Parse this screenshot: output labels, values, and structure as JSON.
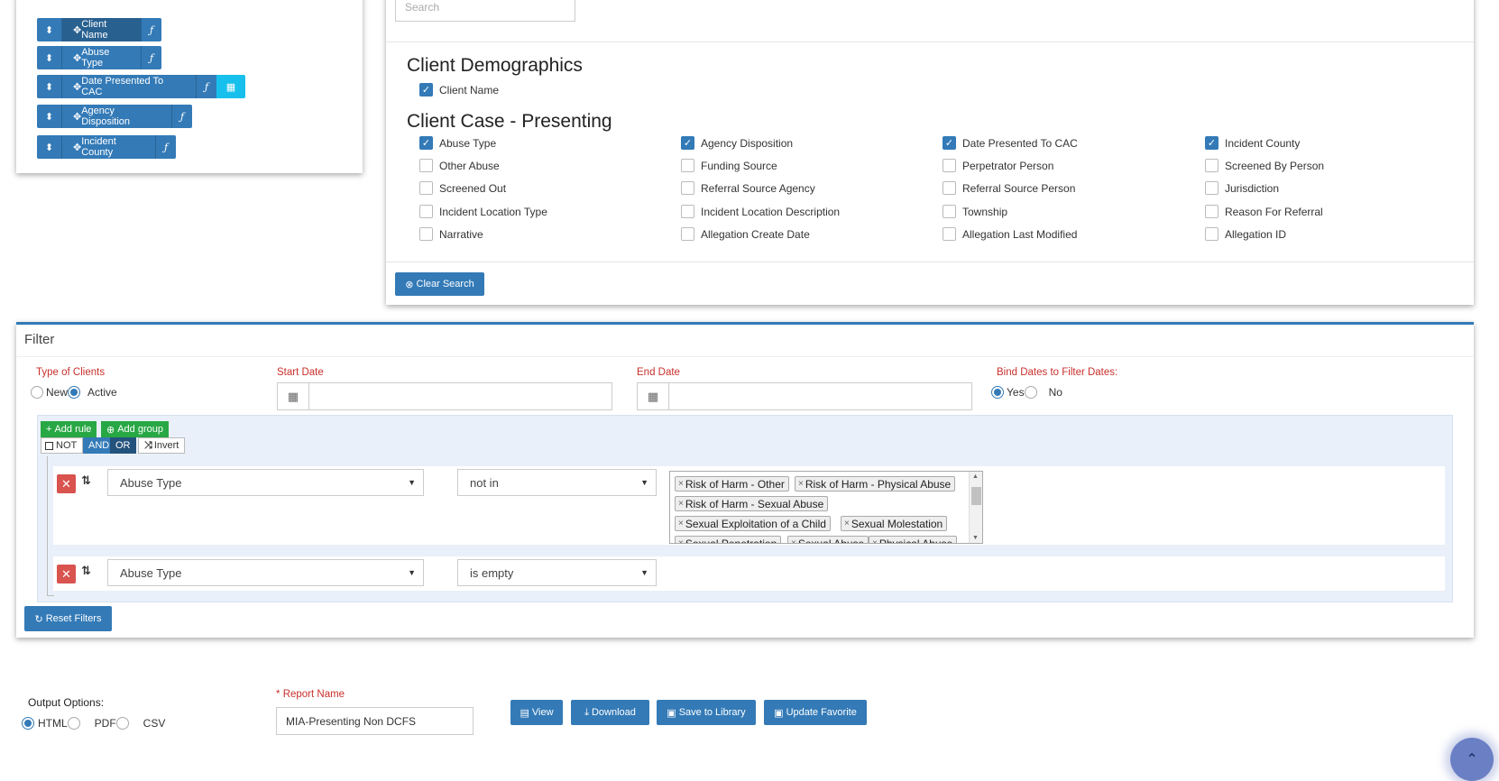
{
  "selected_columns": [
    {
      "name": "Client Name",
      "has_calendar": false
    },
    {
      "name": "Abuse Type",
      "has_calendar": false
    },
    {
      "name": "Date Presented To CAC",
      "has_calendar": true
    },
    {
      "name": "Agency Disposition",
      "has_calendar": false
    },
    {
      "name": "Incident County",
      "has_calendar": false
    }
  ],
  "icons": {
    "sort": "⬍",
    "move": "✥",
    "fx": "ƒ",
    "calendar": "▦",
    "check": "✓",
    "times": "✕",
    "swap": "⇅",
    "caret": "▼"
  },
  "search": {
    "placeholder": "Search"
  },
  "demographics": {
    "title": "Client Demographics",
    "items": [
      {
        "label": "Client Name",
        "checked": true
      }
    ]
  },
  "case_presenting": {
    "title": "Client Case - Presenting",
    "items": [
      {
        "label": "Abuse Type",
        "checked": true
      },
      {
        "label": "Agency Disposition",
        "checked": true
      },
      {
        "label": "Date Presented To CAC",
        "checked": true
      },
      {
        "label": "Incident County",
        "checked": true
      },
      {
        "label": "Other Abuse",
        "checked": false
      },
      {
        "label": "Funding Source",
        "checked": false
      },
      {
        "label": "Perpetrator Person",
        "checked": false
      },
      {
        "label": "Screened By Person",
        "checked": false
      },
      {
        "label": "Screened Out",
        "checked": false
      },
      {
        "label": "Referral Source Agency",
        "checked": false
      },
      {
        "label": "Referral Source Person",
        "checked": false
      },
      {
        "label": "Jurisdiction",
        "checked": false
      },
      {
        "label": "Incident Location Type",
        "checked": false
      },
      {
        "label": "Incident Location Description",
        "checked": false
      },
      {
        "label": "Township",
        "checked": false
      },
      {
        "label": "Reason For Referral",
        "checked": false
      },
      {
        "label": "Narrative",
        "checked": false
      },
      {
        "label": "Allegation Create Date",
        "checked": false
      },
      {
        "label": "Allegation Last Modified",
        "checked": false
      },
      {
        "label": "Allegation ID",
        "checked": false
      }
    ]
  },
  "clear_search_label": "Clear Search",
  "filter": {
    "title": "Filter",
    "type_of_clients": {
      "label": "Type of Clients",
      "options": [
        "New",
        "Active"
      ],
      "selected": "Active"
    },
    "start_date": {
      "label": "Start Date",
      "value": ""
    },
    "end_date": {
      "label": "End Date",
      "value": ""
    },
    "bind_dates": {
      "label": "Bind Dates to Filter Dates:",
      "options": [
        "Yes",
        "No"
      ],
      "selected": "Yes"
    },
    "query_builder": {
      "add_rule": "Add rule",
      "add_group": "Add group",
      "not_label": "NOT",
      "and_label": "AND",
      "or_label": "OR",
      "invert_label": "Invert",
      "rules": [
        {
          "field": "Abuse Type",
          "operator": "not in",
          "values": [
            "Risk of Harm - Other",
            "Risk of Harm - Physical Abuse",
            "Risk of Harm - Sexual Abuse",
            "Sexual Exploitation of a Child",
            "Sexual Molestation",
            "Sexual Penetration",
            "Sexual Abuse",
            "Physical Abuse"
          ]
        },
        {
          "field": "Abuse Type",
          "operator": "is empty",
          "values": []
        }
      ]
    },
    "reset_label": "Reset Filters"
  },
  "output": {
    "label": "Output Options:",
    "options": [
      "HTML",
      "PDF",
      "CSV"
    ],
    "selected": "HTML"
  },
  "report_name": {
    "required_mark": "*",
    "label": "Report Name",
    "value": "MIA-Presenting Non DCFS"
  },
  "actions": {
    "view": "View",
    "download": "Download",
    "save": "Save to Library",
    "update": "Update Favorite"
  },
  "colors": {
    "primary": "#337ab7",
    "info": "#17c0ec",
    "danger": "#d9534f",
    "success": "#28a745",
    "required": "#c9302c"
  }
}
